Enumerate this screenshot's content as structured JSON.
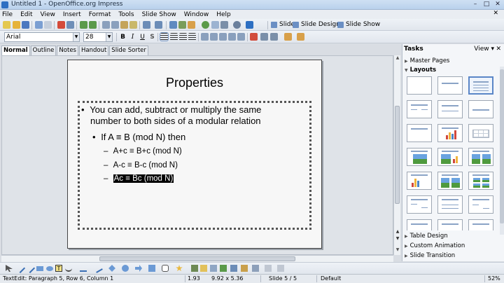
{
  "window": {
    "title": "Untitled 1 - OpenOffice.org Impress",
    "controls": [
      "–",
      "□",
      "✕"
    ]
  },
  "menu": [
    "File",
    "Edit",
    "View",
    "Insert",
    "Format",
    "Tools",
    "Slide Show",
    "Window",
    "Help"
  ],
  "menu_close": "✕",
  "toolbar": {
    "slide_label": "Slide",
    "slide_design_label": "Slide Design",
    "slide_show_label": "Slide Show"
  },
  "formatting": {
    "font_name": "Arial",
    "font_size": "28",
    "bold": "B",
    "italic": "I",
    "underline": "U",
    "shadow": "S"
  },
  "view_tabs": [
    "Normal",
    "Outline",
    "Notes",
    "Handout",
    "Slide Sorter"
  ],
  "active_view_tab": "Normal",
  "slide": {
    "title": "Properties",
    "bullets": [
      {
        "marker": "•",
        "text": "You can add, subtract or multiply the same"
      },
      {
        "marker": "",
        "text": "number to both sides of a modular relation"
      },
      {
        "marker": "•",
        "text": "If A ≡ B (mod N) then"
      },
      {
        "marker": "–",
        "text": "A+c ≡ B+c (mod N)"
      },
      {
        "marker": "–",
        "text": "A-c ≡ B-c (mod N)"
      },
      {
        "marker": "–",
        "text": "Ac ≡ Bc (mod N)"
      }
    ]
  },
  "taskpane": {
    "title": "Tasks",
    "view_label": "View ▾",
    "close": "✕",
    "sections": {
      "master_pages": "Master Pages",
      "layouts": "Layouts",
      "table_design": "Table Design",
      "custom_animation": "Custom Animation",
      "slide_transition": "Slide Transition"
    }
  },
  "statusbar": {
    "edit_info": "TextEdit: Paragraph 5, Row 6, Column 1",
    "position": "1.93",
    "size": "9.92 x 5.36",
    "slide": "Slide 5 / 5",
    "master": "Default",
    "zoom": "52%"
  },
  "colors": {
    "accent": "#5a86c7",
    "titlebar": "#cfe0f3",
    "selection": "#000000"
  }
}
